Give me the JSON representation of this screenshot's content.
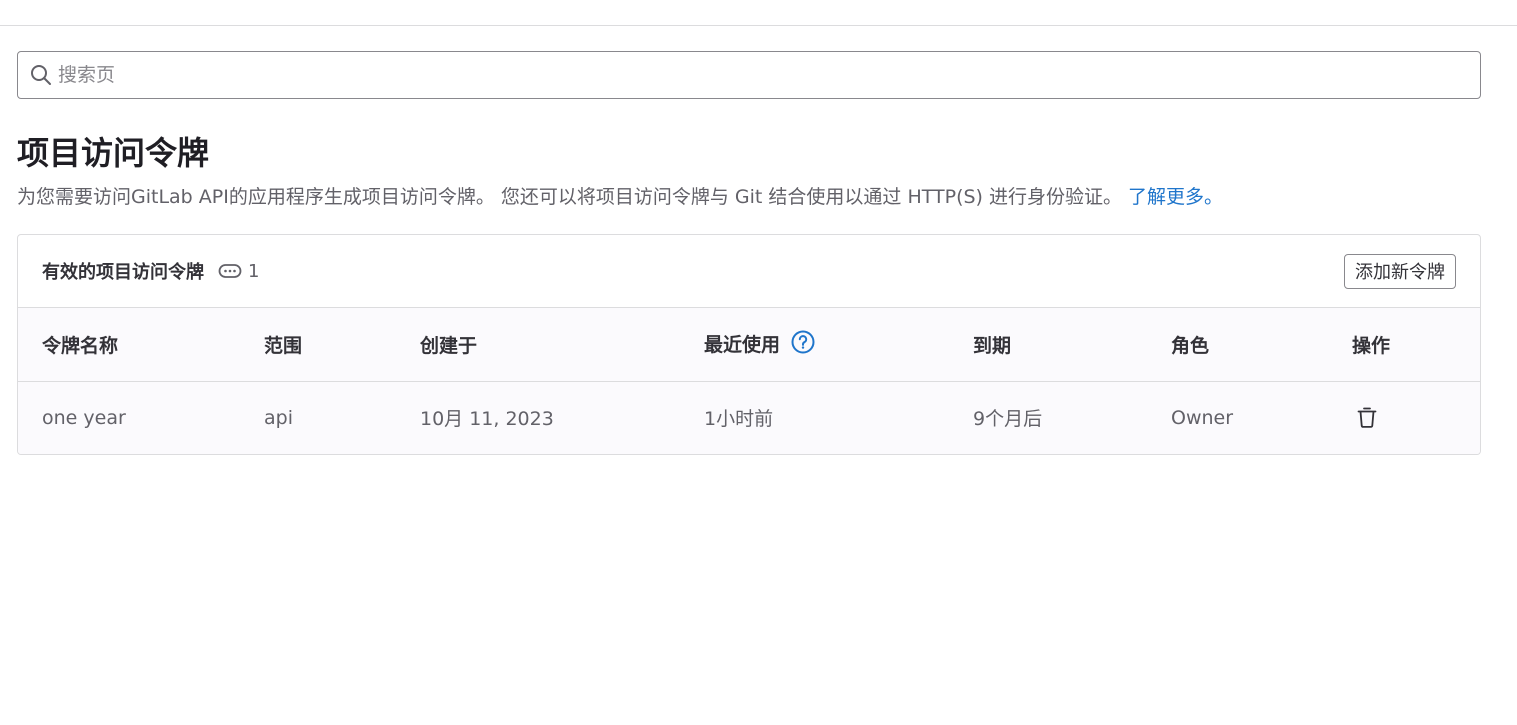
{
  "search": {
    "placeholder": "搜索页",
    "value": ""
  },
  "page": {
    "title": "项目访问令牌",
    "description": "为您需要访问GitLab API的应用程序生成项目访问令牌。 您还可以将项目访问令牌与 Git 结合使用以通过 HTTP(S) 进行身份验证。",
    "learn_more": "了解更多。"
  },
  "card": {
    "title": "有效的项目访问令牌",
    "count": "1",
    "add_button": "添加新令牌"
  },
  "table": {
    "headers": {
      "name": "令牌名称",
      "scope": "范围",
      "created": "创建于",
      "last_used": "最近使用",
      "expires": "到期",
      "role": "角色",
      "actions": "操作"
    },
    "rows": [
      {
        "name": "one year",
        "scope": "api",
        "created": "10月 11, 2023",
        "last_used": "1小时前",
        "expires": "9个月后",
        "role": "Owner"
      }
    ]
  },
  "colors": {
    "link": "#1f75cb",
    "text": "#333238",
    "muted": "#626168",
    "border": "#dcdcde"
  }
}
